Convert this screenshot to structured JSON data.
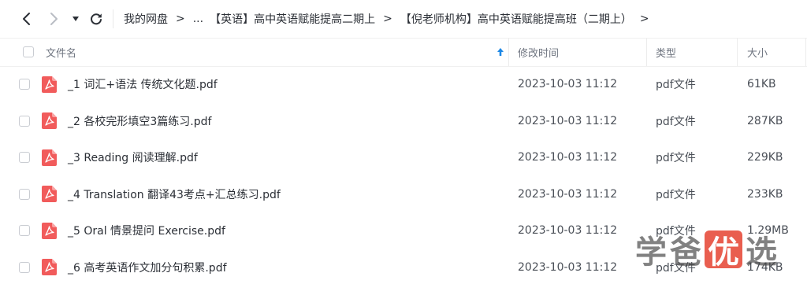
{
  "nav": {
    "back_icon": "chevron-left-icon",
    "forward_icon": "chevron-right-icon",
    "dropdown_icon": "caret-down-icon",
    "refresh_icon": "refresh-icon"
  },
  "breadcrumb": {
    "items": [
      "我的网盘",
      "...",
      "【英语】高中英语赋能提高二期上",
      "【倪老师机构】高中英语赋能提高班（二期上）"
    ],
    "separator": ">"
  },
  "table": {
    "columns": {
      "name": "文件名",
      "modified": "修改时间",
      "type": "类型",
      "size": "大小"
    },
    "sort_icon": "sort-arrow-up-icon",
    "rows": [
      {
        "name": "_1 词汇+语法 传统文化题.pdf",
        "modified": "2023-10-03 11:12",
        "type": "pdf文件",
        "size": "61KB"
      },
      {
        "name": "_2 各校完形填空3篇练习.pdf",
        "modified": "2023-10-03 11:12",
        "type": "pdf文件",
        "size": "287KB"
      },
      {
        "name": "_3 Reading 阅读理解.pdf",
        "modified": "2023-10-03 11:12",
        "type": "pdf文件",
        "size": "229KB"
      },
      {
        "name": "_4 Translation 翻译43考点+汇总练习.pdf",
        "modified": "2023-10-03 11:12",
        "type": "pdf文件",
        "size": "233KB"
      },
      {
        "name": "_5 Oral 情景提问 Exercise.pdf",
        "modified": "2023-10-03 11:12",
        "type": "pdf文件",
        "size": "1.29MB"
      },
      {
        "name": "_6 高考英语作文加分句积累.pdf",
        "modified": "2023-10-03 11:12",
        "type": "pdf文件",
        "size": "174KB"
      }
    ]
  },
  "watermark": {
    "chars": [
      "学",
      "爸",
      "优",
      "选"
    ]
  },
  "colors": {
    "pdf_icon": "#f15b5b",
    "sort_arrow": "#1e88e5",
    "watermark_accent": "#e74c3c"
  }
}
